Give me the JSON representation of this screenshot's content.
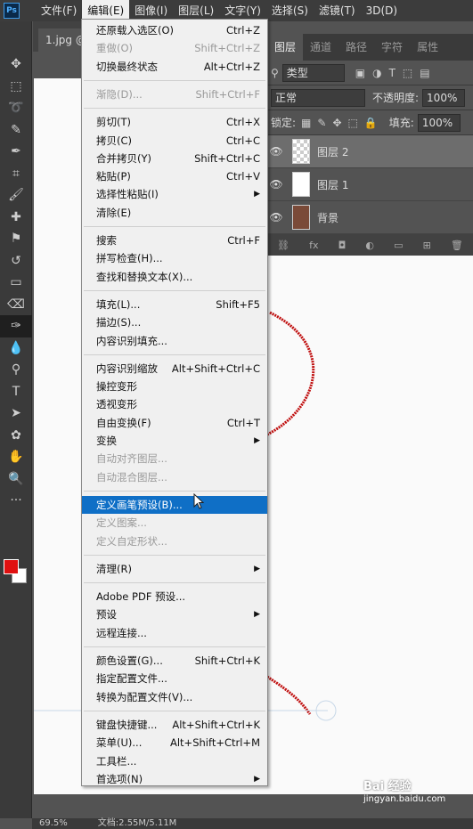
{
  "menubar": {
    "logo": "Ps",
    "items": [
      "文件(F)",
      "编辑(E)",
      "图像(I)",
      "图层(L)",
      "文字(Y)",
      "选择(S)",
      "滤镜(T)",
      "3D(D)"
    ]
  },
  "document": {
    "tab_label": "1.jpg @"
  },
  "tools": [
    "move-icon",
    "marquee-icon",
    "lasso-icon",
    "quick-select-icon",
    "eyedropper-icon",
    "crop-icon",
    "brush-icon",
    "spot-heal-icon",
    "stamp-icon",
    "history-brush-icon",
    "gradient-icon",
    "eraser-icon",
    "pen-icon",
    "blur-icon",
    "dodge-icon",
    "text-icon",
    "path-select-icon",
    "shape-icon",
    "hand-icon",
    "zoom-icon",
    "more-icon"
  ],
  "colors": {
    "foreground": "#e01010",
    "background": "#ffffff",
    "highlight": "#0f6fc6"
  },
  "panel": {
    "tabs": [
      "图层",
      "通道",
      "路径",
      "字符",
      "属性"
    ],
    "filter_label": "类型",
    "blend_mode": "正常",
    "opacity_label": "不透明度:",
    "opacity_value": "100%",
    "lock_label": "锁定:",
    "fill_label": "填充:",
    "fill_value": "100%",
    "layers": [
      {
        "name": "图层 2",
        "selected": true
      },
      {
        "name": "图层 1",
        "selected": false
      },
      {
        "name": "背景",
        "selected": false
      }
    ]
  },
  "edit_menu": {
    "items": [
      {
        "label": "还原载入选区(O)",
        "shortcut": "Ctrl+Z",
        "disabled": false
      },
      {
        "label": "重做(O)",
        "shortcut": "Shift+Ctrl+Z",
        "disabled": true
      },
      {
        "label": "切换最终状态",
        "shortcut": "Alt+Ctrl+Z",
        "disabled": false
      },
      {
        "sep": true
      },
      {
        "label": "渐隐(D)...",
        "shortcut": "Shift+Ctrl+F",
        "disabled": true
      },
      {
        "sep": true
      },
      {
        "label": "剪切(T)",
        "shortcut": "Ctrl+X",
        "disabled": false
      },
      {
        "label": "拷贝(C)",
        "shortcut": "Ctrl+C",
        "disabled": false
      },
      {
        "label": "合并拷贝(Y)",
        "shortcut": "Shift+Ctrl+C",
        "disabled": false
      },
      {
        "label": "粘贴(P)",
        "shortcut": "Ctrl+V",
        "disabled": false
      },
      {
        "label": "选择性粘贴(I)",
        "shortcut": "▶",
        "disabled": false
      },
      {
        "label": "清除(E)",
        "shortcut": "",
        "disabled": false
      },
      {
        "sep": true
      },
      {
        "label": "搜索",
        "shortcut": "Ctrl+F",
        "disabled": false
      },
      {
        "label": "拼写检查(H)...",
        "shortcut": "",
        "disabled": false
      },
      {
        "label": "查找和替换文本(X)...",
        "shortcut": "",
        "disabled": false
      },
      {
        "sep": true
      },
      {
        "label": "填充(L)...",
        "shortcut": "Shift+F5",
        "disabled": false
      },
      {
        "label": "描边(S)...",
        "shortcut": "",
        "disabled": false
      },
      {
        "label": "内容识别填充...",
        "shortcut": "",
        "disabled": false
      },
      {
        "sep": true
      },
      {
        "label": "内容识别缩放",
        "shortcut": "Alt+Shift+Ctrl+C",
        "disabled": false
      },
      {
        "label": "操控变形",
        "shortcut": "",
        "disabled": false
      },
      {
        "label": "透视变形",
        "shortcut": "",
        "disabled": false
      },
      {
        "label": "自由变换(F)",
        "shortcut": "Ctrl+T",
        "disabled": false
      },
      {
        "label": "变换",
        "shortcut": "▶",
        "disabled": false
      },
      {
        "label": "自动对齐图层...",
        "shortcut": "",
        "disabled": true
      },
      {
        "label": "自动混合图层...",
        "shortcut": "",
        "disabled": true
      },
      {
        "sep": true
      },
      {
        "label": "定义画笔预设(B)...",
        "shortcut": "",
        "disabled": false,
        "highlight": true
      },
      {
        "label": "定义图案...",
        "shortcut": "",
        "disabled": true
      },
      {
        "label": "定义自定形状...",
        "shortcut": "",
        "disabled": true
      },
      {
        "sep": true
      },
      {
        "label": "清理(R)",
        "shortcut": "▶",
        "disabled": false
      },
      {
        "sep": true
      },
      {
        "label": "Adobe PDF 预设...",
        "shortcut": "",
        "disabled": false
      },
      {
        "label": "预设",
        "shortcut": "▶",
        "disabled": false
      },
      {
        "label": "远程连接...",
        "shortcut": "",
        "disabled": false
      },
      {
        "sep": true
      },
      {
        "label": "颜色设置(G)...",
        "shortcut": "Shift+Ctrl+K",
        "disabled": false
      },
      {
        "label": "指定配置文件...",
        "shortcut": "",
        "disabled": false
      },
      {
        "label": "转换为配置文件(V)...",
        "shortcut": "",
        "disabled": false
      },
      {
        "sep": true
      },
      {
        "label": "键盘快捷键...",
        "shortcut": "Alt+Shift+Ctrl+K",
        "disabled": false
      },
      {
        "label": "菜单(U)...",
        "shortcut": "Alt+Shift+Ctrl+M",
        "disabled": false
      },
      {
        "label": "工具栏...",
        "shortcut": "",
        "disabled": false
      },
      {
        "label": "首选项(N)",
        "shortcut": "▶",
        "disabled": false
      }
    ]
  },
  "status": {
    "zoom": "69.5%",
    "doc_info": "文档:2.55M/5.11M"
  },
  "watermark": {
    "brand": "Bai 经验",
    "url": "jingyan.baidu.com"
  }
}
